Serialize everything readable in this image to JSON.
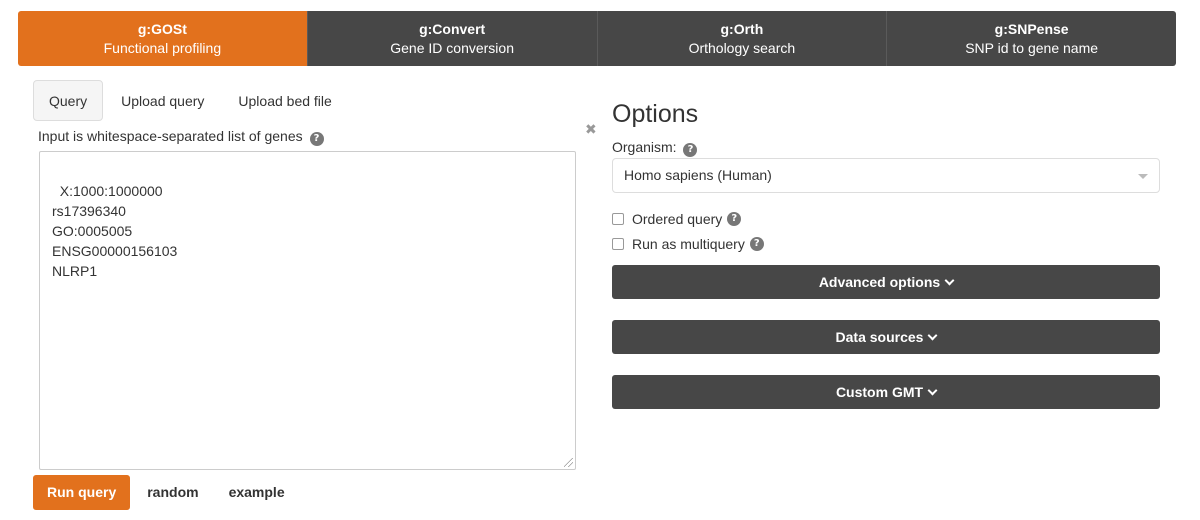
{
  "nav": {
    "items": [
      {
        "title": "g:GOSt",
        "subtitle": "Functional profiling"
      },
      {
        "title": "g:Convert",
        "subtitle": "Gene ID conversion"
      },
      {
        "title": "g:Orth",
        "subtitle": "Orthology search"
      },
      {
        "title": "g:SNPense",
        "subtitle": "SNP id to gene name"
      }
    ],
    "active_index": 0
  },
  "query": {
    "tabs": [
      "Query",
      "Upload query",
      "Upload bed file"
    ],
    "active_tab": 0,
    "input_label": "Input is whitespace-separated list of genes",
    "clear_glyph": "✖",
    "value": "X:1000:1000000\nrs17396340\nGO:0005005\nENSG00000156103\nNLRP1",
    "run_label": "Run query",
    "random_label": "random",
    "example_label": "example"
  },
  "options": {
    "title": "Options",
    "organism_label": "Organism:",
    "organism_value": "Homo sapiens (Human)",
    "ordered_query_label": "Ordered query",
    "ordered_query_checked": false,
    "multiquery_label": "Run as multiquery",
    "multiquery_checked": false,
    "advanced_label": "Advanced options",
    "data_sources_label": "Data sources",
    "custom_gmt_label": "Custom GMT"
  },
  "icons": {
    "help": "question-circle-icon",
    "clear": "clear-icon",
    "chevron": "chevron-down-icon",
    "caret": "caret-down-icon",
    "help_glyph": "?"
  },
  "colors": {
    "accent": "#e2711d",
    "dark": "#474747"
  }
}
